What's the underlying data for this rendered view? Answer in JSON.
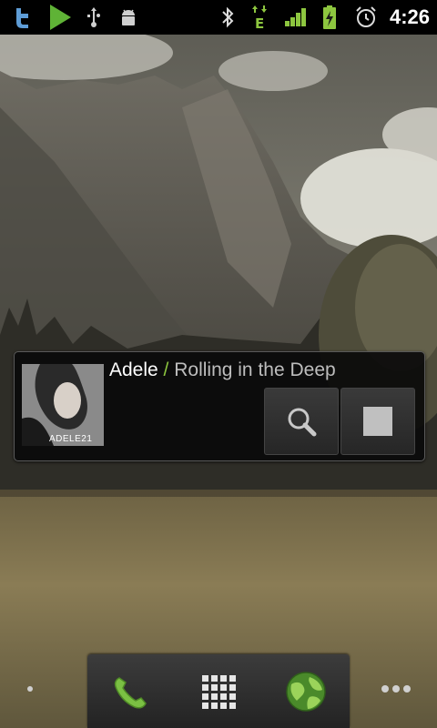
{
  "status_bar": {
    "time": "4:26",
    "icons_left": [
      "twitter-icon",
      "play-store-icon",
      "usb-icon",
      "android-debug-icon"
    ],
    "icons_right": [
      "bluetooth-icon",
      "edge-data-icon",
      "signal-icon",
      "battery-charging-icon",
      "alarm-icon"
    ],
    "network_label": "E",
    "accent_color": "#8dc63f"
  },
  "music_widget": {
    "artist": "Adele",
    "separator": " / ",
    "song": "Rolling in the Deep",
    "album_label": "ADELE21",
    "buttons": [
      "search-icon",
      "stop-icon"
    ]
  },
  "dock": {
    "items": [
      "phone-icon",
      "app-drawer-icon",
      "browser-icon"
    ]
  }
}
